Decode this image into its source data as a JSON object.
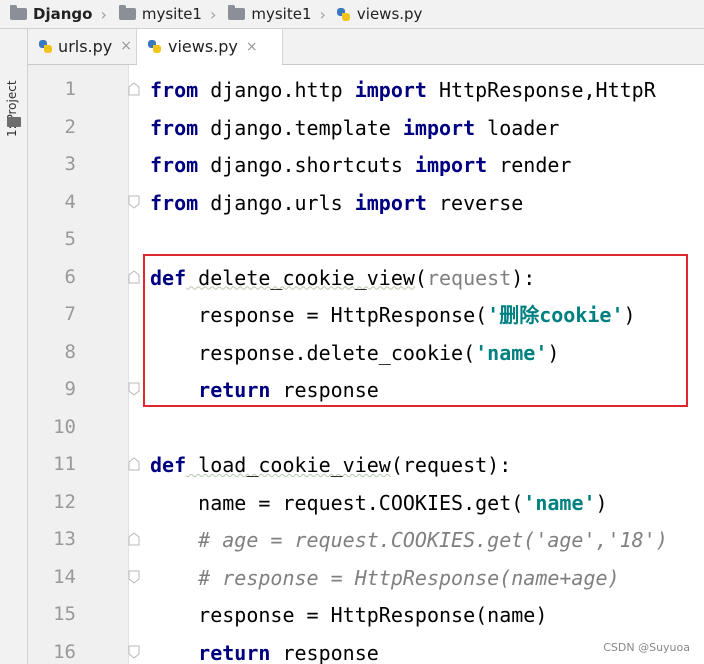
{
  "breadcrumb": {
    "project": "Django",
    "folder1": "mysite1",
    "folder2": "mysite1",
    "file": "views.py"
  },
  "toolwindow": {
    "label": "1: Project"
  },
  "tabs": [
    {
      "label": "urls.py",
      "active": false
    },
    {
      "label": "views.py",
      "active": true
    }
  ],
  "close_glyph": "×",
  "editor": {
    "line_numbers": [
      "1",
      "2",
      "3",
      "4",
      "5",
      "6",
      "7",
      "8",
      "9",
      "10",
      "11",
      "12",
      "13",
      "14",
      "15",
      "16"
    ],
    "lines": [
      [
        {
          "t": "from",
          "c": "kw"
        },
        {
          "t": " django.http "
        },
        {
          "t": "import",
          "c": "kw"
        },
        {
          "t": " HttpResponse,HttpR"
        }
      ],
      [
        {
          "t": "from",
          "c": "kw"
        },
        {
          "t": " django.template "
        },
        {
          "t": "import",
          "c": "kw"
        },
        {
          "t": " loader"
        }
      ],
      [
        {
          "t": "from",
          "c": "kw"
        },
        {
          "t": " django.shortcuts "
        },
        {
          "t": "import",
          "c": "kw"
        },
        {
          "t": " render"
        }
      ],
      [
        {
          "t": "from",
          "c": "kw"
        },
        {
          "t": " django.urls "
        },
        {
          "t": "import",
          "c": "kw"
        },
        {
          "t": " reverse"
        }
      ],
      [],
      [
        {
          "t": "def",
          "c": "kw"
        },
        {
          "t": " delete_cookie_view",
          "c": "wavy"
        },
        {
          "t": "(",
          "c": ""
        },
        {
          "t": "request",
          "c": "param"
        },
        {
          "t": "):"
        }
      ],
      [
        {
          "t": "    response = HttpResponse("
        },
        {
          "t": "'删除cookie'",
          "c": "str"
        },
        {
          "t": ")"
        }
      ],
      [
        {
          "t": "    response.delete_cookie("
        },
        {
          "t": "'name'",
          "c": "str"
        },
        {
          "t": ")"
        }
      ],
      [
        {
          "t": "    "
        },
        {
          "t": "return",
          "c": "kw"
        },
        {
          "t": " response"
        }
      ],
      [],
      [
        {
          "t": "def",
          "c": "kw"
        },
        {
          "t": " load_cookie_view",
          "c": "wavy"
        },
        {
          "t": "(request):"
        }
      ],
      [
        {
          "t": "    name = request.COOKIES.get("
        },
        {
          "t": "'name'",
          "c": "str"
        },
        {
          "t": ")"
        }
      ],
      [
        {
          "t": "    # age = request.COOKIES.get('age','18')",
          "c": "cm"
        }
      ],
      [
        {
          "t": "    # response = HttpResponse(name+age)",
          "c": "cm"
        }
      ],
      [
        {
          "t": "    response = HttpResponse(name)"
        }
      ],
      [
        {
          "t": "    "
        },
        {
          "t": "return",
          "c": "kw"
        },
        {
          "t": " response"
        }
      ]
    ]
  },
  "watermark": "CSDN @Suyuoa"
}
